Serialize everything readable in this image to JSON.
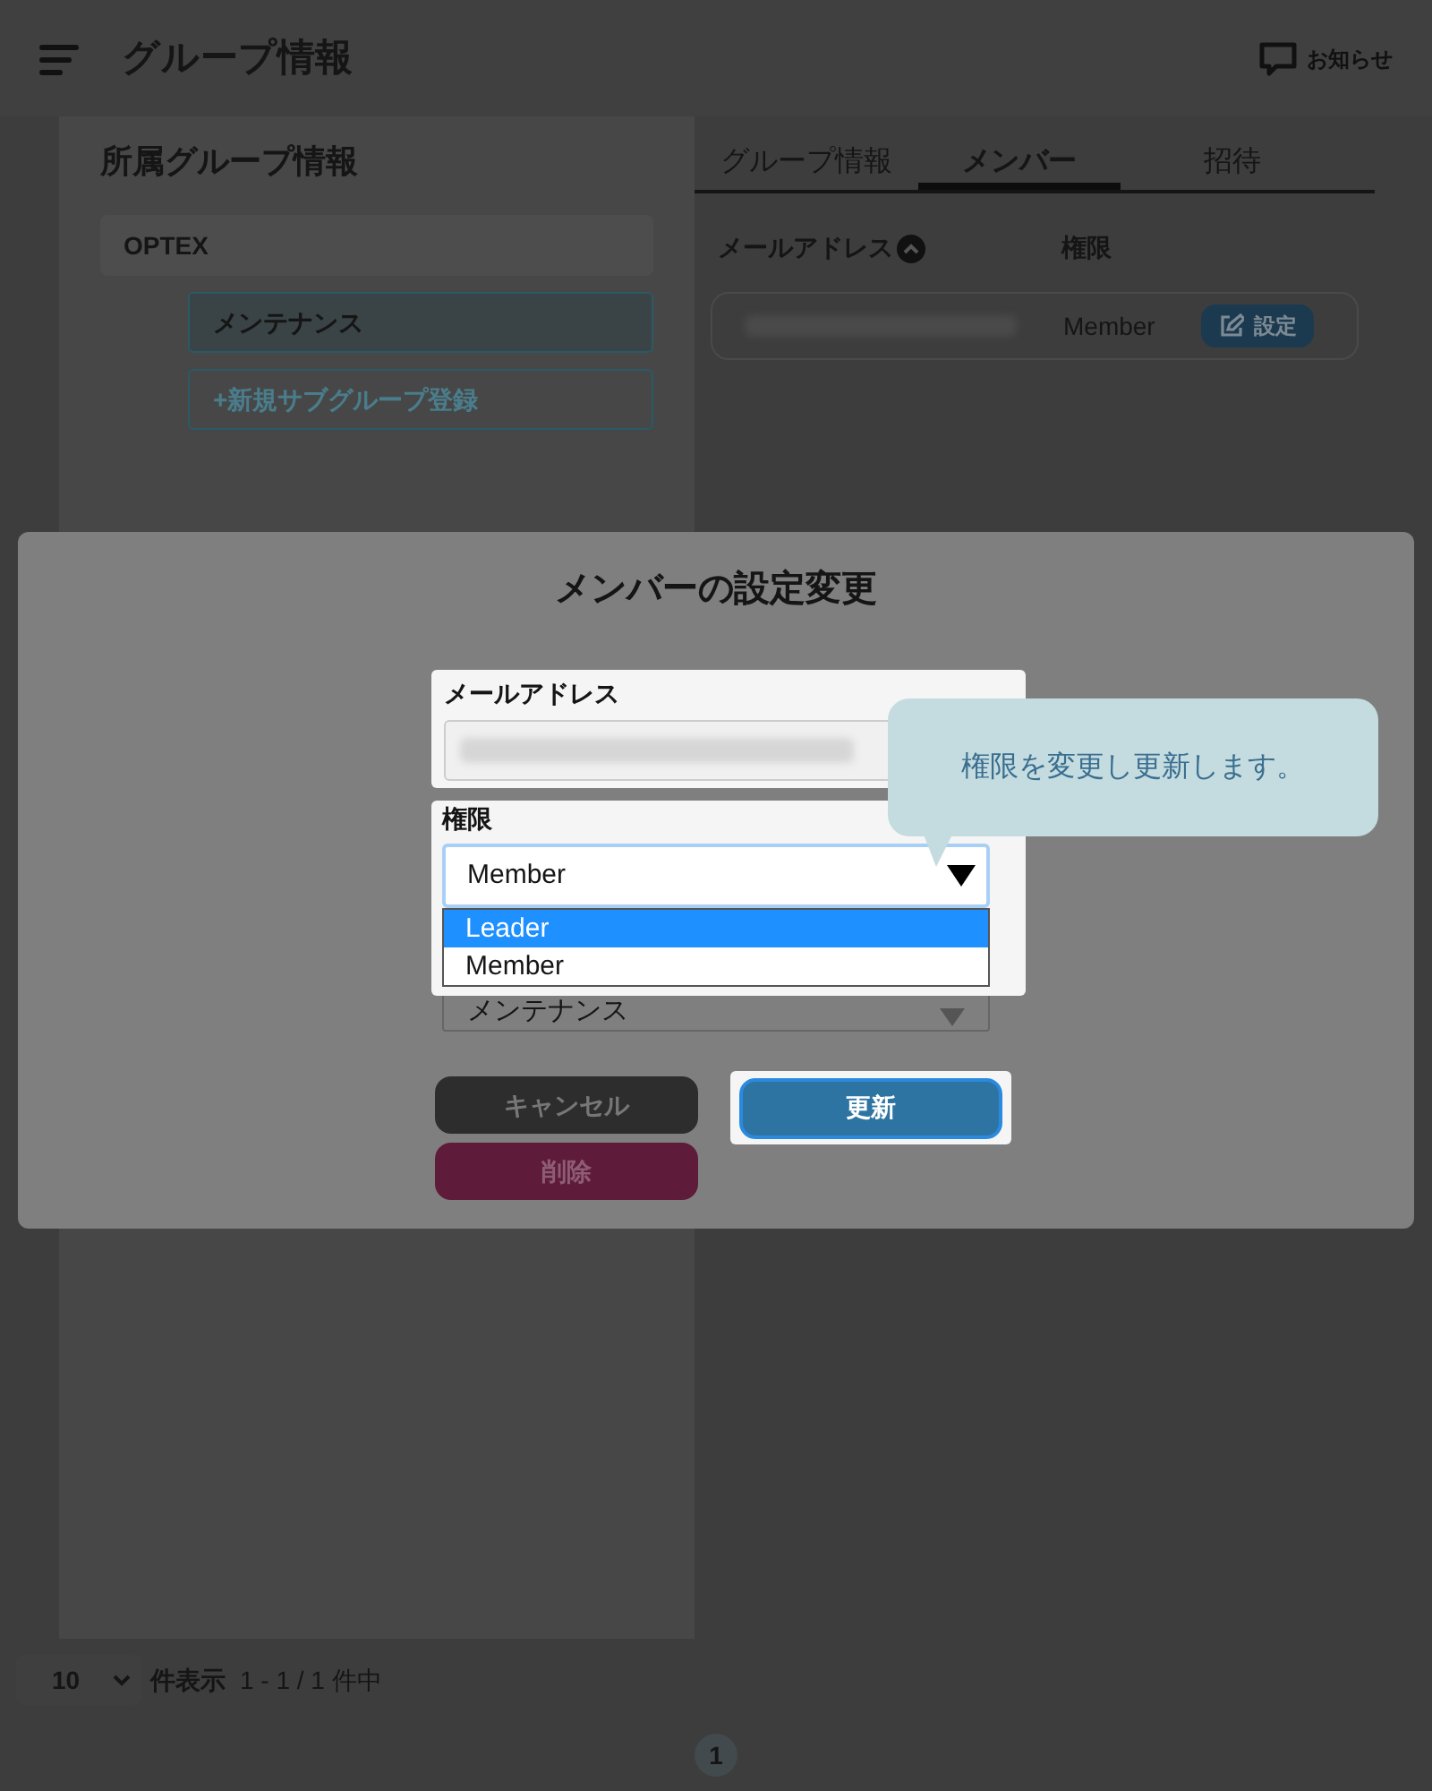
{
  "header": {
    "title": "グループ情報",
    "notice": "お知らせ"
  },
  "sidebar": {
    "title": "所属グループ情報",
    "group": "OPTEX",
    "subgroups": [
      {
        "label": "メンテナンス",
        "selected": true
      }
    ],
    "add_button": "+新規サブグループ登録"
  },
  "tabs": [
    {
      "label": "グループ情報",
      "selected": false
    },
    {
      "label": "メンバー",
      "selected": true
    },
    {
      "label": "招待",
      "selected": false
    }
  ],
  "table": {
    "columns": [
      "メールアドレス",
      "権限"
    ],
    "rows": [
      {
        "role": "Member",
        "action": "設定"
      }
    ]
  },
  "pagination": {
    "page_size": "10",
    "page_size_label": "件表示",
    "range": "1 - 1 / 1 件中",
    "pages": [
      "1"
    ]
  },
  "dialog": {
    "title": "メンバーの設定変更",
    "email_label": "メールアドレス",
    "role_label": "権限",
    "role_value": "Member",
    "role_options": [
      {
        "label": "Leader",
        "selected": true
      },
      {
        "label": "Member",
        "selected": false
      }
    ],
    "group_value": "メンテナンス",
    "buttons": [
      {
        "label": "キャンセル",
        "kind": "cancel"
      },
      {
        "label": "更新",
        "kind": "primary"
      },
      {
        "label": "削除",
        "kind": "danger"
      }
    ]
  },
  "tooltip": "権限を変更し更新します。"
}
